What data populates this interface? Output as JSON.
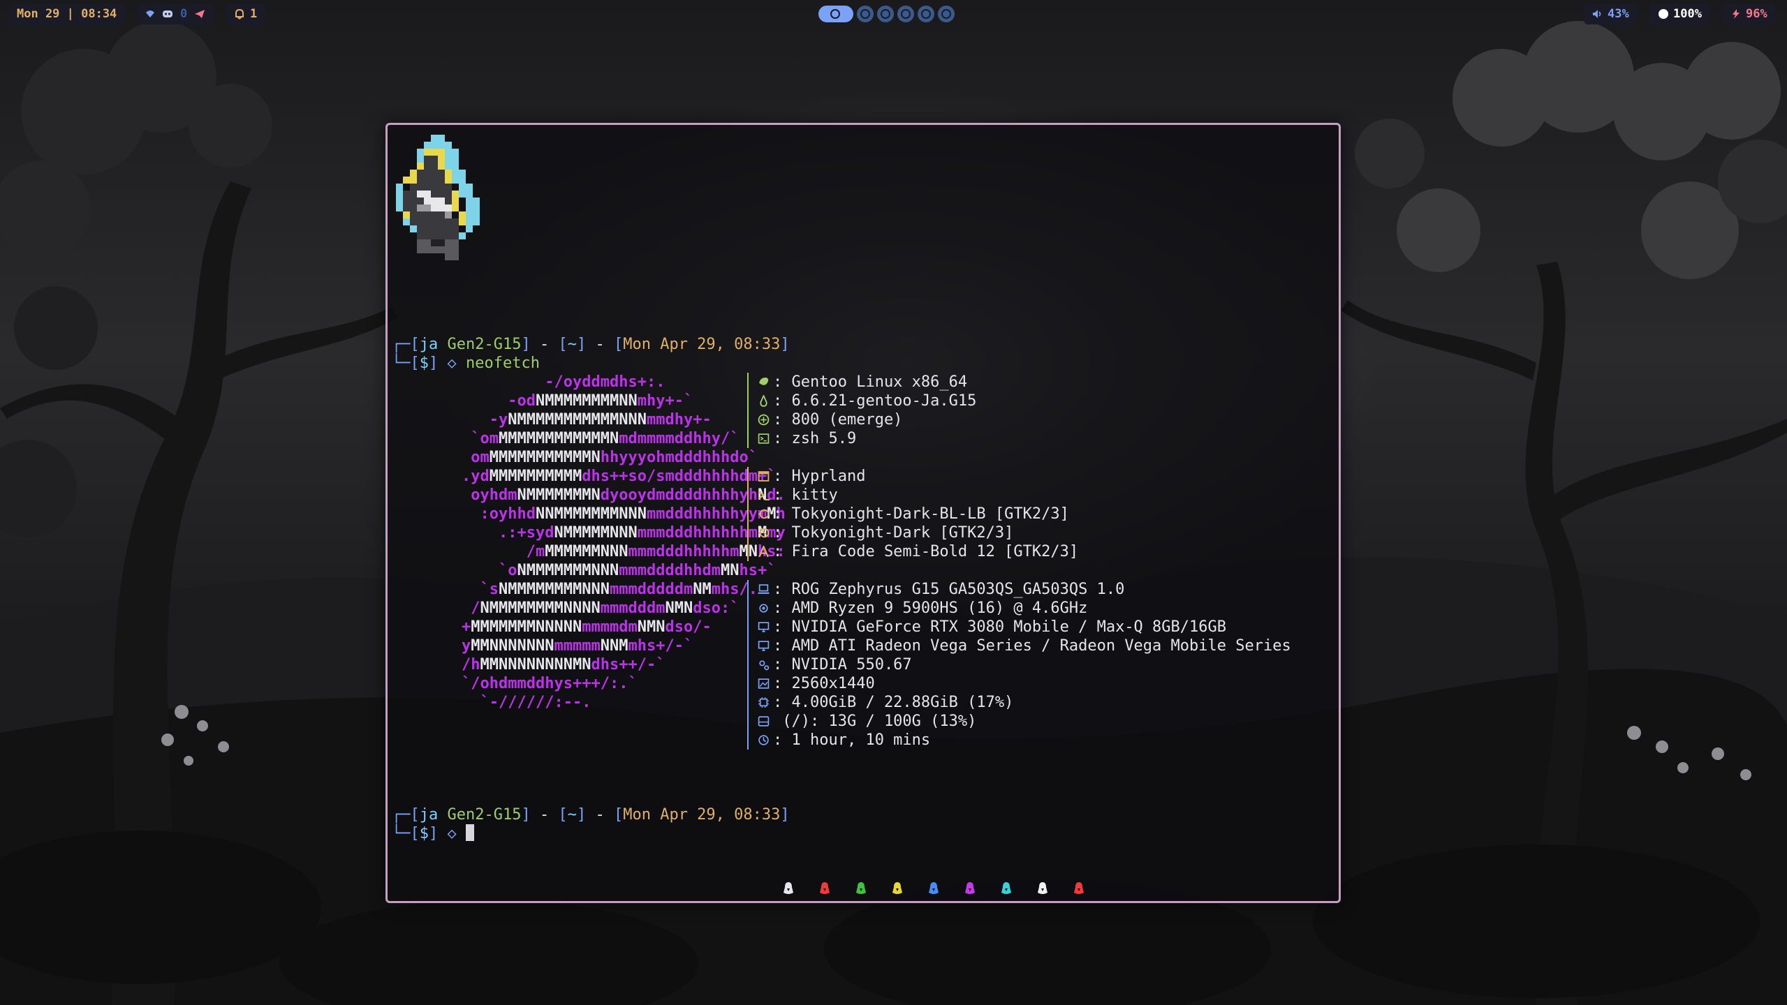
{
  "topbar": {
    "clock": "Mon 29 | 08:34",
    "tray_count": "0",
    "notifications": "1",
    "volume": "43%",
    "brightness": "100%",
    "battery": "96%"
  },
  "terminal": {
    "prompt1": {
      "user": "ja",
      "host": "Gen2-G15",
      "dir": "~",
      "date": "Mon Apr 29, 08:33",
      "dollar": "$",
      "arrow": "◇",
      "command": "neofetch"
    },
    "prompt2": {
      "user": "ja",
      "host": "Gen2-G15",
      "dir": "~",
      "date": "Mon Apr 29, 08:33",
      "dollar": "$",
      "arrow": "◇"
    },
    "ascii_lines": [
      "                 -/oyddmdhs+:.",
      "             -odNMMMMMMMMNNmhy+-`",
      "           -yNMMMMMMMMMMMNNNmmdhy+-",
      "         `omMMMMMMMMMMMMNmdmmmmddhhy/`",
      "         omMMMMMMMMMMMNhhyyyohmdddhhhdo`",
      "        .ydMMMMMMMMMMdhs++so/smdddhhhhdm+`",
      "         oyhdmNMMMMMMMNdyooydmddddhhhhyhNd.",
      "          :oyhhdNNMMMMMMMNNNmmdddhhhhhyymMh",
      "            .:+sydNMMMMMNNNmmmdddhhhhhhmMmy",
      "               /mMMMMMMNNNmmmdddhhhhhmMNhs:",
      "            `oNMMMMMMMNNNmmmddddhhdmMNhs+`",
      "          `sNMMMMMMMMNNNmmmdddddmNMmhs/.",
      "         /NMMMMMMMMNNNNmmmdddmNMNdso:`",
      "        +MMMMMMMNNNNNmmmmdmNMNdso/-",
      "        yMMNNNNNNNmmmmmNNMmhs+/-`",
      "        /hMMNNNNNNNNMNdhs++/-`",
      "        `/ohdmmddhys+++/:.`",
      "          `-//////:--."
    ],
    "info_group1": [
      {
        "icon": "gentoo-icon",
        "text": ": Gentoo Linux x86_64"
      },
      {
        "icon": "kernel-icon",
        "text": ": 6.6.21-gentoo-Ja.G15"
      },
      {
        "icon": "package-icon",
        "text": ": 800 (emerge)"
      },
      {
        "icon": "shell-icon",
        "text": ": zsh 5.9"
      }
    ],
    "info_group2": [
      {
        "icon": "window-manager-icon",
        "text": ": Hyprland"
      },
      {
        "icon": "terminal-icon",
        "text": ": kitty"
      },
      {
        "icon": "theme-icon",
        "text": ": Tokyonight-Dark-BL-LB [GTK2/3]"
      },
      {
        "icon": "icons-theme-icon",
        "text": ": Tokyonight-Dark [GTK2/3]"
      },
      {
        "icon": "font-icon",
        "text": ": Fira Code Semi-Bold 12 [GTK2/3]"
      }
    ],
    "info_group3": [
      {
        "icon": "laptop-icon",
        "text": ": ROG Zephyrus G15 GA503QS_GA503QS 1.0"
      },
      {
        "icon": "cpu-icon",
        "text": ": AMD Ryzen 9 5900HS (16) @ 4.6GHz"
      },
      {
        "icon": "gpu-icon",
        "text": ": NVIDIA GeForce RTX 3080 Mobile / Max-Q 8GB/16GB"
      },
      {
        "icon": "gpu-icon",
        "text": ": AMD ATI Radeon Vega Series / Radeon Vega Mobile Series"
      },
      {
        "icon": "driver-icon",
        "text": ": NVIDIA 550.67"
      },
      {
        "icon": "resolution-icon",
        "text": ": 2560x1440"
      },
      {
        "icon": "memory-icon",
        "text": ": 4.00GiB / 22.88GiB (17%)"
      },
      {
        "icon": "disk-icon",
        "text": " (/): 13G / 100G (13%)"
      },
      {
        "icon": "uptime-icon",
        "text": ": 1 hour, 10 mins"
      }
    ],
    "palette_colors": [
      "#e6e6ec",
      "#f23a3a",
      "#3fc23f",
      "#e6d63a",
      "#4a8cf0",
      "#c43ae6",
      "#3ad0d6",
      "#f0f0f0",
      "#f23a3a"
    ]
  },
  "colors": {
    "accent": "#7aa2f7",
    "border": "#c59ec1",
    "magenta": "#bb33e6",
    "green": "#9ece6a",
    "yellow": "#e0af68"
  }
}
